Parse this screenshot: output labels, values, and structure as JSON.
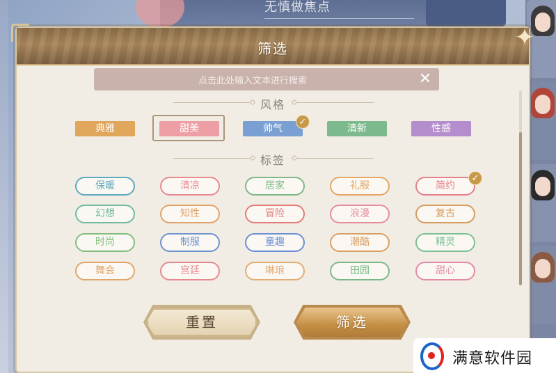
{
  "background": {
    "title": "无慎做焦点"
  },
  "dialog": {
    "title": "筛选",
    "search": {
      "placeholder": "点击此处输入文本进行搜索"
    },
    "style_section": {
      "title": "风格",
      "chips": [
        {
          "label": "典雅",
          "color": "#e0a65c",
          "checked": false,
          "framed": false
        },
        {
          "label": "甜美",
          "color": "#ee9fa5",
          "checked": false,
          "framed": true
        },
        {
          "label": "帅气",
          "color": "#7a9fd3",
          "checked": true,
          "framed": false
        },
        {
          "label": "清新",
          "color": "#7cb98c",
          "checked": false,
          "framed": false
        },
        {
          "label": "性感",
          "color": "#b48dcd",
          "checked": false,
          "framed": false
        }
      ]
    },
    "tag_section": {
      "title": "标签",
      "tags": [
        {
          "label": "保暖",
          "color": "#5fa9be",
          "checked": false
        },
        {
          "label": "清凉",
          "color": "#e78a91",
          "checked": false
        },
        {
          "label": "居家",
          "color": "#7eb886",
          "checked": false
        },
        {
          "label": "礼服",
          "color": "#e3a866",
          "checked": false
        },
        {
          "label": "简约",
          "color": "#e48088",
          "checked": true
        },
        {
          "label": "幻想",
          "color": "#6fbaa0",
          "checked": false
        },
        {
          "label": "知性",
          "color": "#e0a36a",
          "checked": false
        },
        {
          "label": "冒险",
          "color": "#e37b7b",
          "checked": false
        },
        {
          "label": "浪漫",
          "color": "#e58ba0",
          "checked": false
        },
        {
          "label": "复古",
          "color": "#d69b5e",
          "checked": false
        },
        {
          "label": "时尚",
          "color": "#82bd7e",
          "checked": false
        },
        {
          "label": "制服",
          "color": "#6f93cf",
          "checked": false
        },
        {
          "label": "童趣",
          "color": "#6b8fd6",
          "checked": false
        },
        {
          "label": "潮酷",
          "color": "#d8a064",
          "checked": false
        },
        {
          "label": "精灵",
          "color": "#7cbf95",
          "checked": false
        },
        {
          "label": "舞会",
          "color": "#e0a56b",
          "checked": false
        },
        {
          "label": "宫廷",
          "color": "#e48a8e",
          "checked": false
        },
        {
          "label": "琳琅",
          "color": "#e2ad74",
          "checked": false
        },
        {
          "label": "田园",
          "color": "#7ab986",
          "checked": false
        },
        {
          "label": "甜心",
          "color": "#e38aa7",
          "checked": false
        }
      ]
    },
    "buttons": {
      "reset": "重置",
      "filter": "筛选"
    },
    "scroll_position": 0.78
  },
  "side_cards": [
    {
      "hair": "#3b3b3b"
    },
    {
      "hair": "#b0463a"
    },
    {
      "hair": "#2a2a2a"
    },
    {
      "hair": "#8b5a42"
    }
  ],
  "watermark": {
    "text": "满意软件园"
  },
  "icons": {
    "close": "close-icon",
    "check": "check-icon",
    "ornament": "star-ornament-icon"
  }
}
